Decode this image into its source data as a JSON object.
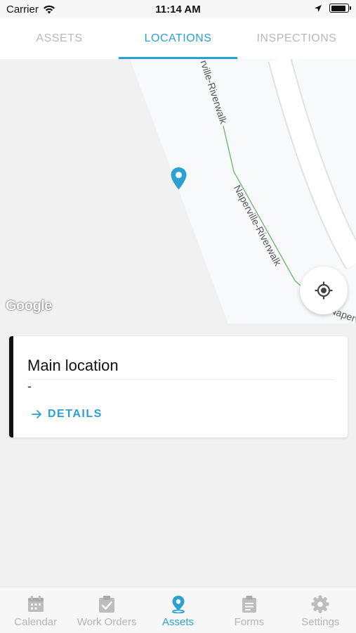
{
  "status_bar": {
    "carrier": "Carrier",
    "time": "11:14 AM",
    "battery_level": 0.9
  },
  "top_tabs": [
    {
      "label": "ASSETS",
      "active": false
    },
    {
      "label": "LOCATIONS",
      "active": true
    },
    {
      "label": "INSPECTIONS",
      "active": false
    }
  ],
  "map": {
    "road_label_1": "rville-Riverwalk",
    "road_label_2": "Naperville-Riverwalk",
    "road_label_3": "Naperv",
    "logo_text": "Google",
    "pin_color": "#2aa1d3"
  },
  "location_card": {
    "title": "Main location",
    "subtitle": "-",
    "details_label": "DETAILS"
  },
  "bottom_nav": [
    {
      "label": "Calendar",
      "icon": "calendar-icon",
      "active": false
    },
    {
      "label": "Work Orders",
      "icon": "clipboard-check-icon",
      "active": false
    },
    {
      "label": "Assets",
      "icon": "map-pin-icon",
      "active": true
    },
    {
      "label": "Forms",
      "icon": "form-icon",
      "active": false
    },
    {
      "label": "Settings",
      "icon": "gear-icon",
      "active": false
    }
  ],
  "colors": {
    "accent": "#2aa1d3",
    "inactive": "#b4b4b4",
    "card_bar": "#111111"
  }
}
